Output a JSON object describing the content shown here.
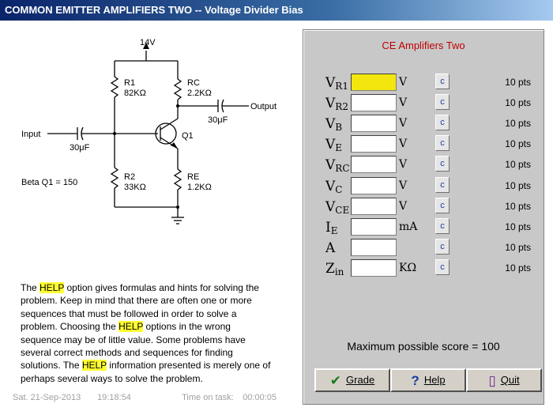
{
  "window": {
    "title": "COMMON EMITTER AMPLIFIERS TWO -- Voltage Divider Bias"
  },
  "circuit": {
    "supply": "14V",
    "r1": "R1",
    "r1_value": "82KΩ",
    "rc": "RC",
    "rc_value": "2.2KΩ",
    "r2": "R2",
    "r2_value": "33KΩ",
    "re": "RE",
    "re_value": "1.2KΩ",
    "transistor": "Q1",
    "input_label": "Input",
    "output_label": "Output",
    "cap_in": "30μF",
    "cap_out": "30μF",
    "beta": "Beta Q1 = 150"
  },
  "help": {
    "p1": "The ",
    "h1": "HELP",
    "p2": " option gives formulas and hints for solving the problem. Keep in mind that there are often one or more sequences that must be followed in order to solve a problem. Choosing the ",
    "h2": "HELP",
    "p3": " options in the wrong sequence may be of little value. Some problems have several correct methods and sequences for finding solutions. The ",
    "h3": "HELP",
    "p4": " information presented is merely one of perhaps several ways to solve the problem."
  },
  "status": {
    "date": "Sat.  21-Sep-2013",
    "time": "19:18:54",
    "task_label": "Time on task:",
    "task_time": "00:00:05"
  },
  "panel": {
    "title": "CE Amplifiers Two",
    "c_label": "c",
    "rows": [
      {
        "sym": "V",
        "sub": "R1",
        "unit": "V",
        "value": "",
        "pts": "10 pts"
      },
      {
        "sym": "V",
        "sub": "R2",
        "unit": "V",
        "value": "",
        "pts": "10 pts"
      },
      {
        "sym": "V",
        "sub": "B",
        "unit": "V",
        "value": "",
        "pts": "10 pts"
      },
      {
        "sym": "V",
        "sub": "E",
        "unit": "V",
        "value": "",
        "pts": "10 pts"
      },
      {
        "sym": "V",
        "sub": "RC",
        "unit": "V",
        "value": "",
        "pts": "10 pts"
      },
      {
        "sym": "V",
        "sub": "C",
        "unit": "V",
        "value": "",
        "pts": "10 pts"
      },
      {
        "sym": "V",
        "sub": "CE",
        "unit": "V",
        "value": "",
        "pts": "10 pts"
      },
      {
        "sym": "I",
        "sub": "E",
        "unit": "mA",
        "value": "",
        "pts": "10 pts"
      },
      {
        "sym": "A",
        "sub": "",
        "unit": "",
        "value": "",
        "pts": "10 pts"
      },
      {
        "sym": "Z",
        "sub": "in",
        "unit": "KΩ",
        "value": "",
        "pts": "10 pts"
      }
    ],
    "score": "Maximum possible score = 100",
    "grade": "Grade",
    "help_btn": "Help",
    "quit": "Quit"
  },
  "colors": {
    "title_bar": "#0a246a",
    "panel_title": "#c00000",
    "highlight": "#ffff33",
    "active_input": "#f2e60e"
  }
}
